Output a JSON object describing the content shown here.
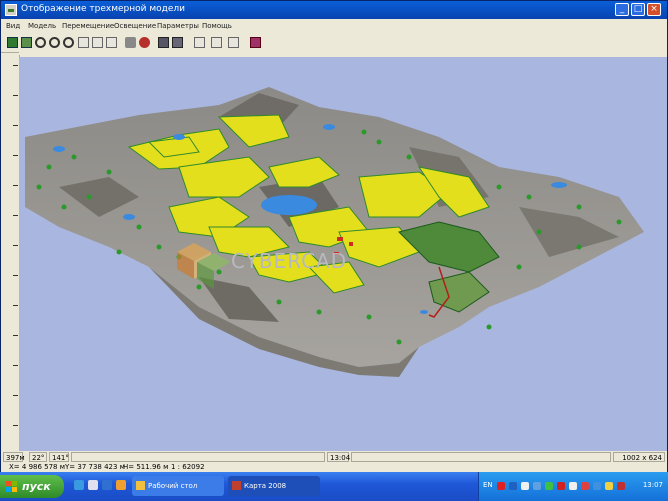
{
  "window": {
    "title": "Отображение трехмерной модели",
    "buttons": {
      "minimize": "_",
      "maximize": "□",
      "close": "×"
    }
  },
  "menu": [
    "Вид",
    "Модель",
    "Перемещение",
    "Освещение",
    "Параметры",
    "Помощь"
  ],
  "toolbar": {
    "icons": [
      "grid-icon",
      "table-icon",
      "tools-icon",
      "zoom-in-icon",
      "zoom-out-icon",
      "zoom-window-icon",
      "zoom-extents-icon",
      "fit-icon",
      "flyover-icon",
      "camera-icon",
      "render-icon",
      "layers-icon",
      "frame-icon",
      "split-icon",
      "rect-icon",
      "book-icon"
    ]
  },
  "viewport": {
    "watermark": "CYBERCAD",
    "background_color": "#a9b6df"
  },
  "status": {
    "distance": "397м",
    "angle_v": "22°",
    "angle_h": "141°",
    "time": "13:04",
    "resolution": "1002 x 624"
  },
  "coords": {
    "x": "X= 4 986 578 м",
    "y": "Y= 37 738 423 м",
    "h": "H= 511.96 м",
    "scale": "1 : 62092"
  },
  "taskbar": {
    "start_label": "пуск",
    "tasks": [
      {
        "label": "Рабочий стол"
      },
      {
        "label": "Карта 2008"
      }
    ],
    "lang": "EN",
    "clock": "13:07"
  }
}
